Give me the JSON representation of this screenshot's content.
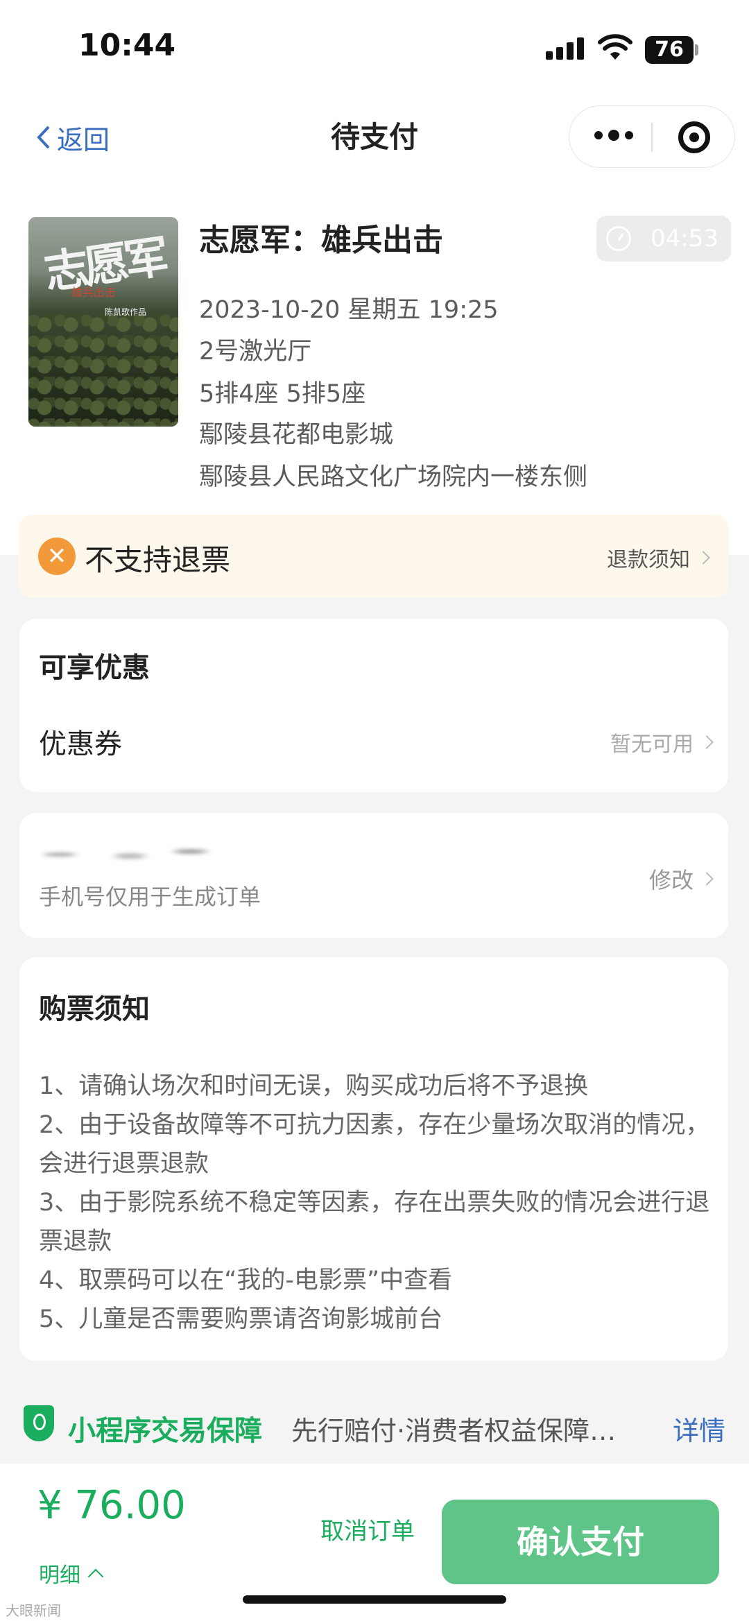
{
  "status_bar": {
    "time": "10:44",
    "battery": "76"
  },
  "nav": {
    "back_label": "返回",
    "title": "待支付"
  },
  "movie": {
    "title": "志愿军：雄兵出击",
    "countdown": "04:53",
    "poster_title": "志愿军",
    "poster_subtitle": "雄兵出击",
    "poster_note": "陈凯歌作品",
    "datetime": "2023-10-20 星期五 19:25",
    "hall": "2号激光厅",
    "seats": "5排4座 5排5座",
    "cinema": "鄢陵县花都电影城",
    "address": "鄢陵县人民路文化广场院内一楼东侧"
  },
  "refund": {
    "icon": "x-icon",
    "label": "不支持退票",
    "link": "退款须知"
  },
  "discount": {
    "heading": "可享优惠",
    "coupon_label": "优惠券",
    "coupon_status": "暂无可用"
  },
  "phone": {
    "note": "手机号仅用于生成订单",
    "edit_label": "修改"
  },
  "notice": {
    "heading": "购票须知",
    "rules": [
      "1、请确认场次和时间无误，购买成功后将不予退换",
      "2、由于设备故障等不可抗力因素，存在少量场次取消的情况，会进行退票退款",
      "3、由于影院系统不稳定等因素，存在出票失败的情况会进行退票退款",
      "4、取票码可以在“我的-电影票”中查看",
      "5、儿童是否需要购票请咨询影城前台"
    ]
  },
  "guarantee": {
    "title": "小程序交易保障",
    "desc": "先行赔付·消费者权益保障…",
    "link": "详情"
  },
  "footer": {
    "price": "¥ 76.00",
    "detail_label": "明细",
    "cancel_label": "取消订单",
    "pay_label": "确认支付"
  },
  "watermark": "大眼新闻",
  "colors": {
    "accent_green": "#1aad5d",
    "pay_button": "#5fc487",
    "link_blue": "#3a6fbf",
    "warning_orange": "#f29a3a"
  }
}
